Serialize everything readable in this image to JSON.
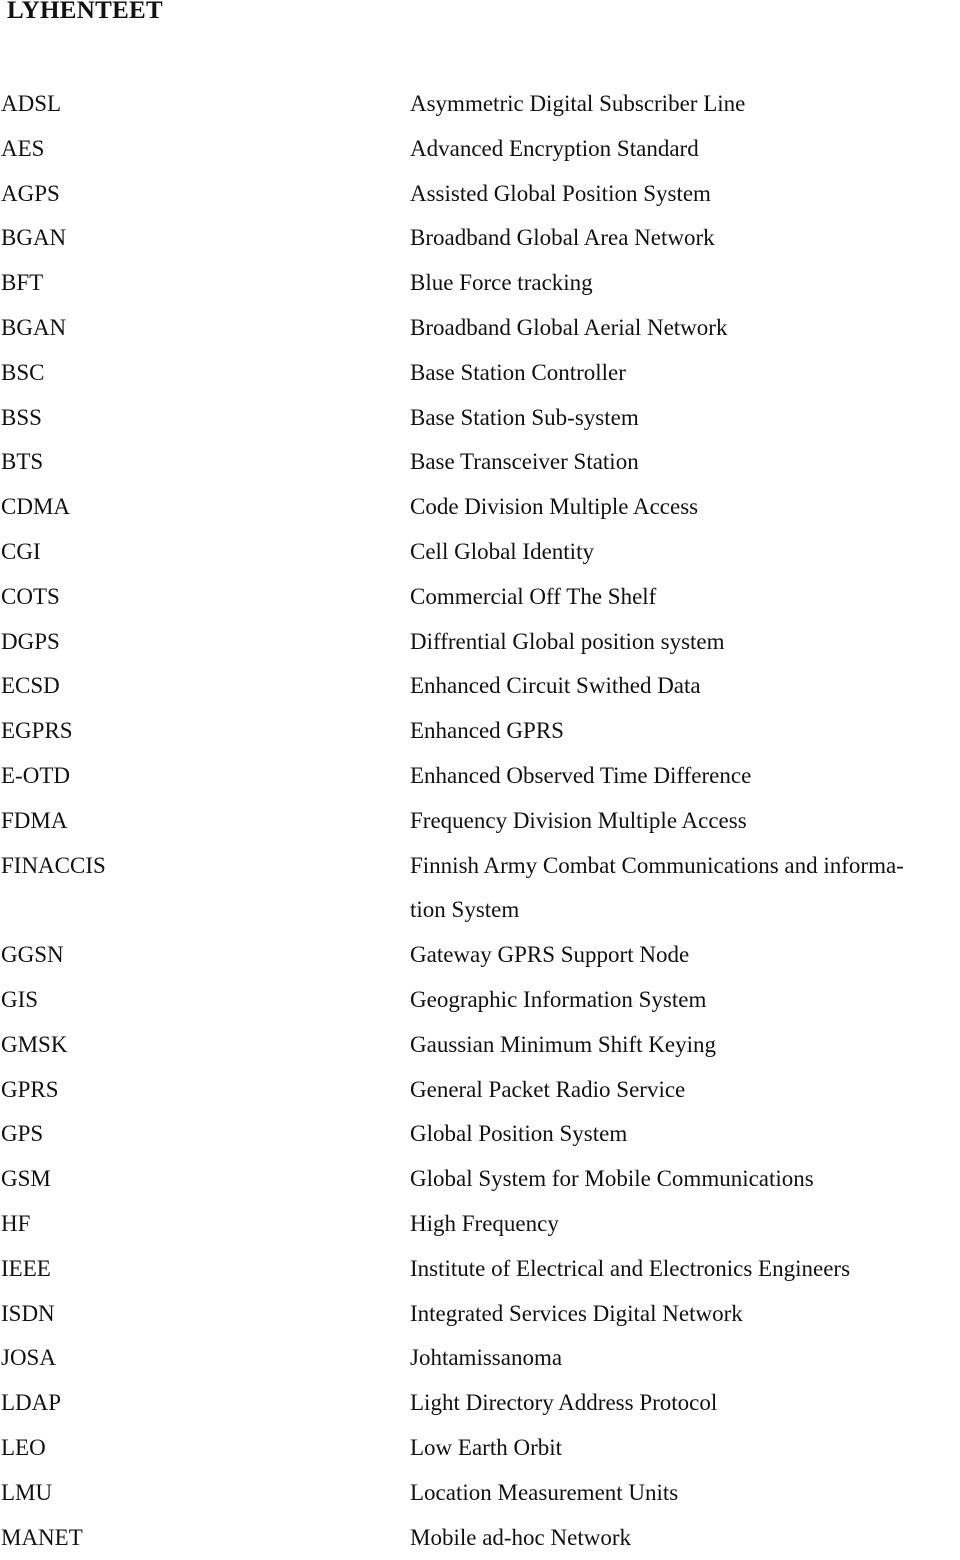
{
  "page": {
    "title": "LYHENTEET"
  },
  "abbreviations": [
    {
      "abbr": "ADSL",
      "definition": "Asymmetric Digital Subscriber Line"
    },
    {
      "abbr": "AES",
      "definition": "Advanced Encryption Standard"
    },
    {
      "abbr": "AGPS",
      "definition": "Assisted Global Position System"
    },
    {
      "abbr": "BGAN",
      "definition": "Broadband Global Area Network"
    },
    {
      "abbr": "BFT",
      "definition": "Blue Force tracking"
    },
    {
      "abbr": "BGAN",
      "definition": "Broadband Global Aerial Network"
    },
    {
      "abbr": "BSC",
      "definition": "Base Station Controller"
    },
    {
      "abbr": "BSS",
      "definition": "Base Station Sub-system"
    },
    {
      "abbr": "BTS",
      "definition": "Base Transceiver Station"
    },
    {
      "abbr": "CDMA",
      "definition": "Code Division Multiple Access"
    },
    {
      "abbr": "CGI",
      "definition": "Cell Global Identity"
    },
    {
      "abbr": "COTS",
      "definition": "Commercial Off The Shelf"
    },
    {
      "abbr": "DGPS",
      "definition": "Diffrential Global position system"
    },
    {
      "abbr": "ECSD",
      "definition": "Enhanced Circuit Swithed Data"
    },
    {
      "abbr": "EGPRS",
      "definition": "Enhanced GPRS"
    },
    {
      "abbr": "E-OTD",
      "definition": "Enhanced Observed Time Difference"
    },
    {
      "abbr": "FDMA",
      "definition": "Frequency Division Multiple Access"
    },
    {
      "abbr": "FINACCIS",
      "definition": "Finnish Army Combat Communications and informa-\ntion System"
    },
    {
      "abbr": "GGSN",
      "definition": "Gateway GPRS Support Node"
    },
    {
      "abbr": "GIS",
      "definition": "Geographic Information System"
    },
    {
      "abbr": "GMSK",
      "definition": "Gaussian Minimum Shift Keying"
    },
    {
      "abbr": "GPRS",
      "definition": "General Packet Radio Service"
    },
    {
      "abbr": "GPS",
      "definition": "Global Position System"
    },
    {
      "abbr": "GSM",
      "definition": "Global System for Mobile Communications"
    },
    {
      "abbr": "HF",
      "definition": "High Frequency"
    },
    {
      "abbr": "IEEE",
      "definition": "Institute of Electrical and Electronics Engineers"
    },
    {
      "abbr": "ISDN",
      "definition": "Integrated Services Digital Network"
    },
    {
      "abbr": "JOSA",
      "definition": "Johtamissanoma"
    },
    {
      "abbr": "LDAP",
      "definition": "Light Directory Address Protocol"
    },
    {
      "abbr": "LEO",
      "definition": "Low Earth Orbit"
    },
    {
      "abbr": "LMU",
      "definition": "Location Measurement Units"
    },
    {
      "abbr": "MANET",
      "definition": "Mobile ad-hoc Network"
    }
  ]
}
